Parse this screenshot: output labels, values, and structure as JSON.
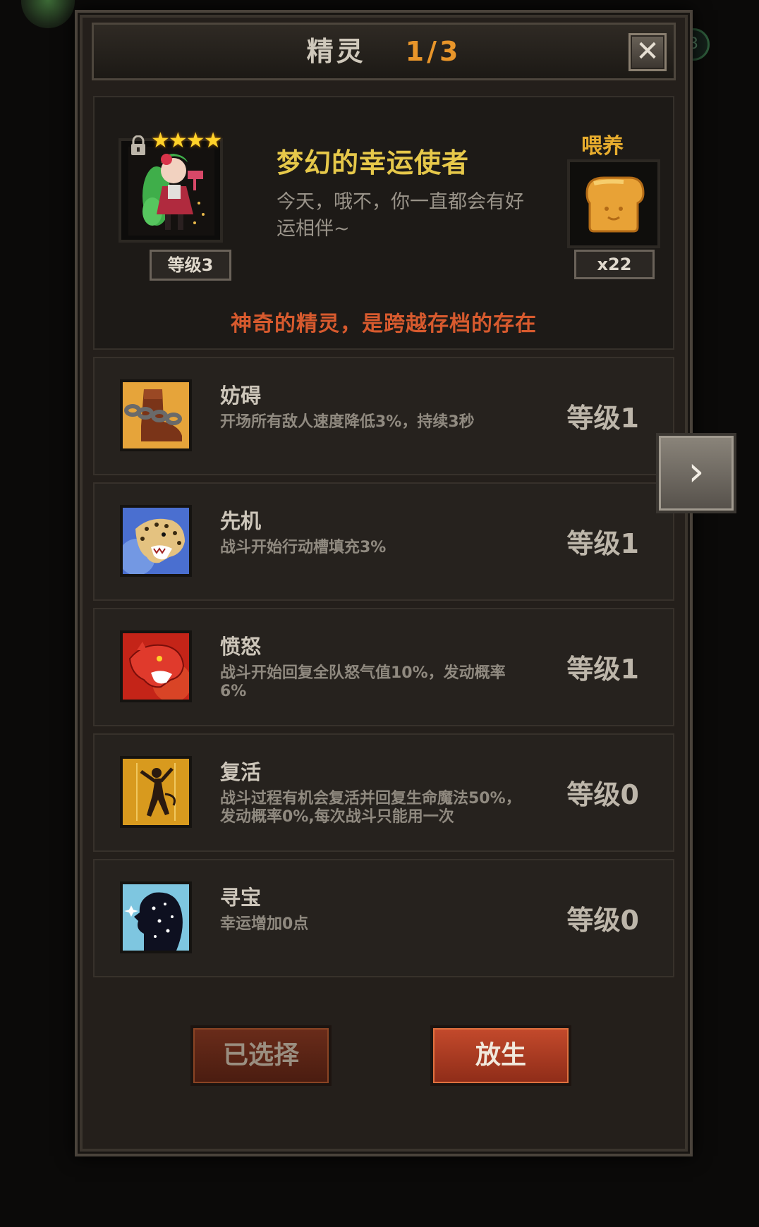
{
  "header": {
    "title": "精灵",
    "page_indicator": "1/3"
  },
  "spirit": {
    "name": "梦幻的幸运使者",
    "description": "今天，哦不，你一直都会有好运相伴~",
    "stars": "★★★★",
    "level_label": "等级3",
    "locked": true
  },
  "feed": {
    "label": "喂养",
    "count": "x22"
  },
  "note": "神奇的精灵，是跨越存档的存在",
  "skills": [
    {
      "name": "妨碍",
      "desc": "开场所有敌人速度降低3%，持续3秒",
      "level": "等级1"
    },
    {
      "name": "先机",
      "desc": "战斗开始行动槽填充3%",
      "level": "等级1"
    },
    {
      "name": "愤怒",
      "desc": "战斗开始回复全队怒气值10%，发动概率6%",
      "level": "等级1"
    },
    {
      "name": "复活",
      "desc": "战斗过程有机会复活并回复生命魔法50%，发动概率0%,每次战斗只能用一次",
      "level": "等级0"
    },
    {
      "name": "寻宝",
      "desc": "幸运增加0点",
      "level": "等级0"
    }
  ],
  "buttons": {
    "selected": "已选择",
    "release": "放生"
  },
  "icons": {
    "close": "close-icon",
    "lock": "lock-icon",
    "feed_item": "bread-icon",
    "next": "chevron-right-icon",
    "skills": [
      "chain-boot-icon",
      "leopard-icon",
      "panther-icon",
      "dancer-icon",
      "silhouette-icon"
    ]
  },
  "colors": {
    "page_indicator": "#e8952a",
    "spirit_name": "#e6c84a",
    "feed_label": "#e8ad2e",
    "note": "#d75a2e",
    "star": "#ffd22a"
  }
}
